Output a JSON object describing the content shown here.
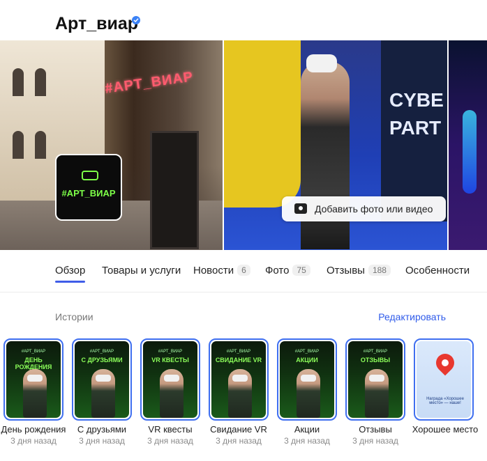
{
  "org": {
    "title": "Арт_виар",
    "verified_icon": "verified-check-icon"
  },
  "gallery": {
    "add_media_label": "Добавить фото или видео",
    "sign_text": "#АРТ_ВИАР",
    "logo_text": "#АРТ_ВИАР",
    "poster_lines": [
      "CYBE",
      "PART"
    ]
  },
  "tabs": [
    {
      "label": "Обзор",
      "count": "",
      "active": true
    },
    {
      "label": "Товары и услуги",
      "count": ""
    },
    {
      "label": "Новости",
      "count": "6"
    },
    {
      "label": "Фото",
      "count": "75"
    },
    {
      "label": "Отзывы",
      "count": "188"
    },
    {
      "label": "Особенности",
      "count": ""
    }
  ],
  "stories": {
    "heading": "Истории",
    "edit_label": "Редактировать",
    "items": [
      {
        "name": "День рождения",
        "time": "3 дня назад",
        "caption": "ДЕНЬ РОЖДЕНИЯ",
        "brand": "#АРТ_ВИАР"
      },
      {
        "name": "С друзьями",
        "time": "3 дня назад",
        "caption": "С ДРУЗЬЯМИ",
        "brand": "#АРТ_ВИАР"
      },
      {
        "name": "VR квесты",
        "time": "3 дня назад",
        "caption": "VR КВЕСТЫ",
        "brand": "#АРТ_ВИАР"
      },
      {
        "name": "Свидание VR",
        "time": "3 дня назад",
        "caption": "СВИДАНИЕ VR",
        "brand": "#АРТ_ВИАР"
      },
      {
        "name": "Акции",
        "time": "3 дня назад",
        "caption": "АКЦИИ",
        "brand": "#АРТ_ВИАР"
      },
      {
        "name": "Отзывы",
        "time": "3 дня назад",
        "caption": "ОТЗЫВЫ",
        "brand": "#АРТ_ВИАР"
      },
      {
        "name": "Хорошее место",
        "time": "",
        "caption": "",
        "brand": "",
        "badge_text": "Награда «Хорошее место» — наше!"
      }
    ]
  },
  "colors": {
    "accent": "#3f5de8",
    "link": "#2f5bea",
    "story_border": "#3f6ff0",
    "neon": "#8cff5a"
  }
}
